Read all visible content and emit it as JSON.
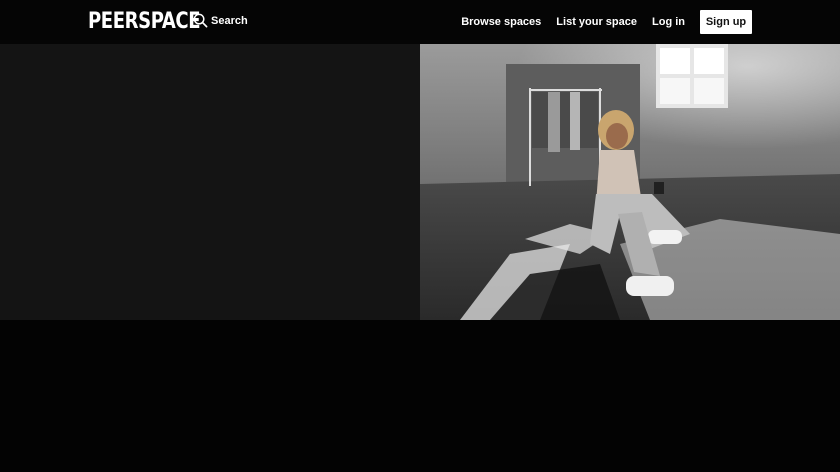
{
  "navbar": {
    "logo": "PEERSPACE",
    "search_label": "Search",
    "links": {
      "browse": "Browse spaces",
      "list": "List your space",
      "login": "Log in",
      "signup": "Sign up"
    }
  },
  "hero": {
    "image_icon": "photo-studio-woman-phone"
  },
  "colors": {
    "background": "#040404",
    "panel": "#141414",
    "signup_bg": "#ffffff",
    "text": "#ffffff"
  }
}
